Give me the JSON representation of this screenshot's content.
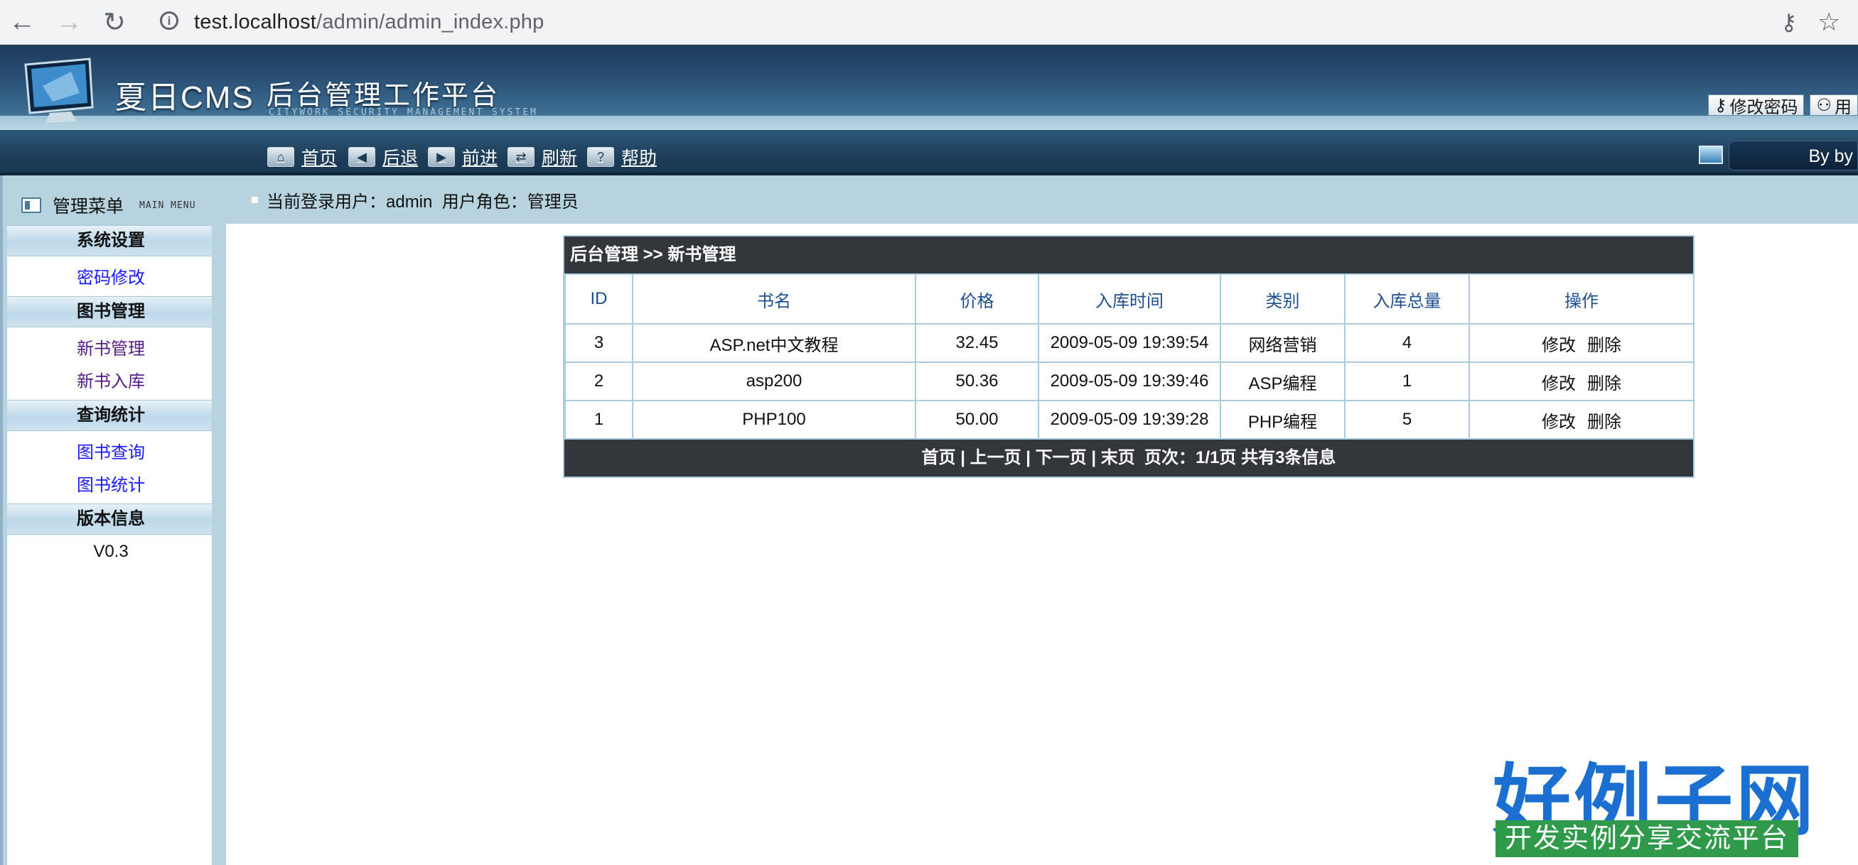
{
  "browser": {
    "url_host": "test.localhost",
    "url_path": "/admin/admin_index.php"
  },
  "header": {
    "brand": "夏日CMS",
    "subtitle": "后台管理工作平台",
    "subtitle_en": "CITYWORK SECURITY MANAGEMENT SYSTEM",
    "tabs": [
      {
        "label": "修改密码",
        "icon": "key-icon"
      },
      {
        "label": "用",
        "icon": "user-icon"
      }
    ]
  },
  "toolbar": {
    "items": [
      {
        "label": "首页",
        "icon": "home-icon"
      },
      {
        "label": "后退",
        "icon": "arrow-left-icon"
      },
      {
        "label": "前进",
        "icon": "arrow-right-icon"
      },
      {
        "label": "刷新",
        "icon": "refresh-icon"
      },
      {
        "label": "帮助",
        "icon": "help-icon"
      }
    ],
    "byline": "By by"
  },
  "sidebar": {
    "title": "管理菜单",
    "title_en": "MAIN MENU",
    "sections": [
      {
        "title": "系统设置",
        "items": [
          {
            "label": "密码修改",
            "visited": false
          }
        ]
      },
      {
        "title": "图书管理",
        "items": [
          {
            "label": "新书管理",
            "visited": true
          },
          {
            "label": "新书入库",
            "visited": true
          }
        ]
      },
      {
        "title": "查询统计",
        "items": [
          {
            "label": "图书查询",
            "visited": false
          },
          {
            "label": "图书统计",
            "visited": false
          }
        ]
      },
      {
        "title": "版本信息",
        "items": []
      }
    ],
    "version": "V0.3"
  },
  "userbar": {
    "text": "当前登录用户：admin  用户角色：管理员"
  },
  "table": {
    "title": "后台管理 >> 新书管理",
    "columns": [
      "ID",
      "书名",
      "价格",
      "入库时间",
      "类别",
      "入库总量",
      "操作"
    ],
    "rows": [
      {
        "id": "3",
        "name": "ASP.net中文教程",
        "price": "32.45",
        "time": "2009-05-09 19:39:54",
        "category": "网络营销",
        "total": "4",
        "edit": "修改",
        "delete": "删除"
      },
      {
        "id": "2",
        "name": "asp200",
        "price": "50.36",
        "time": "2009-05-09 19:39:46",
        "category": "ASP编程",
        "total": "1",
        "edit": "修改",
        "delete": "删除"
      },
      {
        "id": "1",
        "name": "PHP100",
        "price": "50.00",
        "time": "2009-05-09 19:39:28",
        "category": "PHP编程",
        "total": "5",
        "edit": "修改",
        "delete": "删除"
      }
    ],
    "pager": "首页 | 上一页 | 下一页 | 末页  页次：1/1页 共有3条信息"
  },
  "watermark": {
    "brand": "好例子网",
    "slogan": "开发实例分享交流平台"
  }
}
